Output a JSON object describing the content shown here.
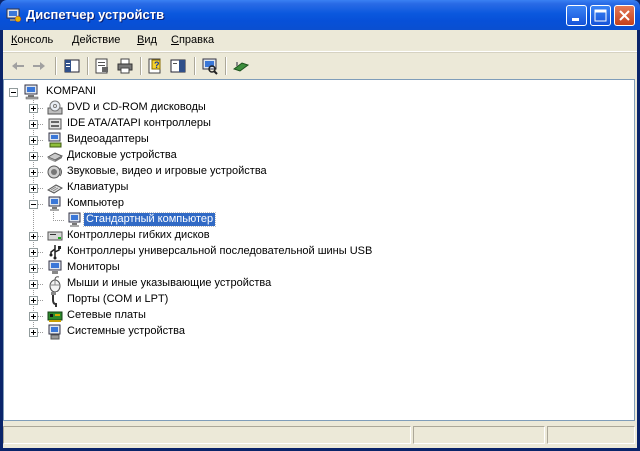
{
  "window": {
    "title": "Диспетчер устройств"
  },
  "menu": [
    {
      "label": "Консоль",
      "hotkey": "К",
      "rest": "онсоль"
    },
    {
      "label": "Действие",
      "hotkey": "Д",
      "rest": "ействие"
    },
    {
      "label": "Вид",
      "hotkey": "В",
      "rest": "ид"
    },
    {
      "label": "Справка",
      "hotkey": "С",
      "rest": "правка"
    }
  ],
  "toolbar": [
    "back-icon",
    "forward-icon",
    "show-hide-tree-icon",
    "properties-icon",
    "print-icon",
    "help-icon",
    "show-hide-action-pane-icon",
    "scan-hardware-icon",
    "update-driver-icon"
  ],
  "tree": {
    "root": "KOMPANI",
    "items": [
      {
        "label": "DVD и CD-ROM дисководы",
        "icon": "dvd-drive-icon"
      },
      {
        "label": "IDE ATA/ATAPI контроллеры",
        "icon": "ide-controller-icon"
      },
      {
        "label": "Видеоадаптеры",
        "icon": "display-adapter-icon"
      },
      {
        "label": "Дисковые устройства",
        "icon": "disk-drive-icon"
      },
      {
        "label": "Звуковые, видео и игровые устройства",
        "icon": "sound-device-icon"
      },
      {
        "label": "Клавиатуры",
        "icon": "keyboard-icon"
      },
      {
        "label": "Компьютер",
        "icon": "computer-icon",
        "expanded": true,
        "children": [
          {
            "label": "Стандартный компьютер",
            "icon": "computer-icon",
            "selected": true
          }
        ]
      },
      {
        "label": "Контроллеры гибких дисков",
        "icon": "floppy-controller-icon"
      },
      {
        "label": "Контроллеры универсальной последовательной шины USB",
        "icon": "usb-icon"
      },
      {
        "label": "Мониторы",
        "icon": "monitor-icon"
      },
      {
        "label": "Мыши и иные указывающие устройства",
        "icon": "mouse-icon"
      },
      {
        "label": "Порты (COM и LPT)",
        "icon": "port-icon"
      },
      {
        "label": "Сетевые платы",
        "icon": "network-card-icon"
      },
      {
        "label": "Системные устройства",
        "icon": "system-device-icon"
      }
    ]
  },
  "colors": {
    "title_bar": "#0b58de",
    "selection": "#316ac5",
    "window_bg": "#ece9d8"
  }
}
